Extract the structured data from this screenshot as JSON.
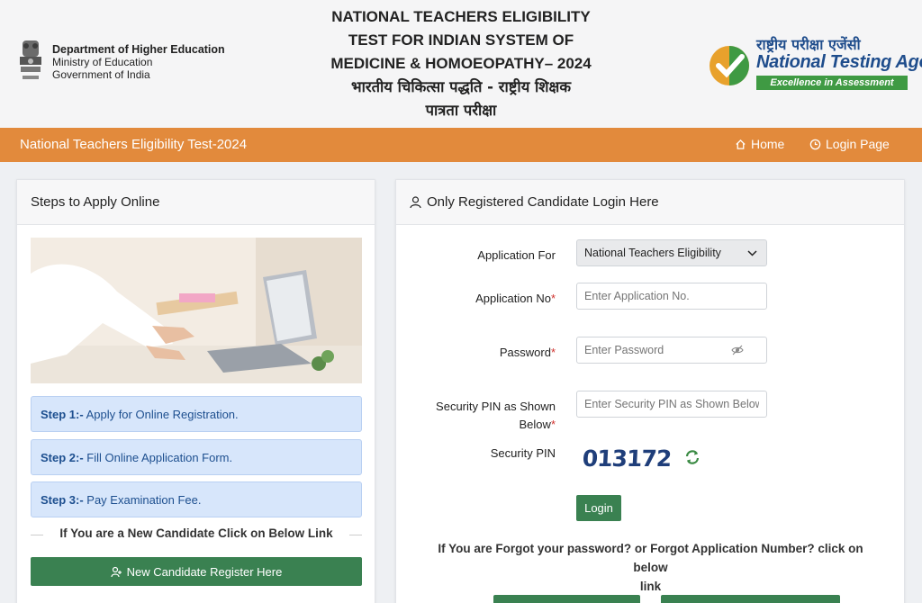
{
  "header": {
    "dept_line1": "Department of Higher Education",
    "dept_line2": "Ministry of Education",
    "dept_line3": "Government of India",
    "title_en_1": "NATIONAL TEACHERS ELIGIBILITY",
    "title_en_2": "TEST FOR INDIAN SYSTEM OF",
    "title_en_3": "MEDICINE & HOMOEOPATHY– 2024",
    "title_hi_1": "भारतीय चिकित्सा पद्धति - राष्ट्रीय शिक्षक",
    "title_hi_2": "पात्रता परीक्षा",
    "nta_hindi": "राष्ट्रीय परीक्षा एजेंसी",
    "nta_english": "National Testing Agency",
    "nta_tagline": "Excellence in Assessment"
  },
  "nav": {
    "brand": "National Teachers Eligibility Test-2024",
    "home": "Home",
    "login_page": "Login Page"
  },
  "left_panel": {
    "heading": "Steps to Apply Online",
    "steps": [
      {
        "prefix": "Step 1:-",
        "text": " Apply for Online Registration."
      },
      {
        "prefix": "Step 2:-",
        "text": " Fill Online Application Form."
      },
      {
        "prefix": "Step 3:-",
        "text": " Pay Examination Fee."
      }
    ],
    "new_candidate_text": "If You are a New Candidate Click on Below Link",
    "register_button": "New Candidate Register Here"
  },
  "right_panel": {
    "heading": "Only Registered Candidate Login Here",
    "application_for_label": "Application For",
    "application_for_value": "National Teachers Eligibility",
    "application_no_label": "Application No",
    "application_no_placeholder": "Enter Application No.",
    "password_label": "Password",
    "password_placeholder": "Enter Password",
    "security_pin_label_1": "Security PIN as Shown",
    "security_pin_label_2": "Below",
    "security_pin_placeholder": "Enter Security PIN as Shown Below",
    "security_pin_display_label": "Security PIN",
    "captcha_value": "013172",
    "login_button": "Login",
    "forgot_text_1": "If You are Forgot your password? or Forgot Application Number? click on below",
    "forgot_text_2": "link",
    "required_mark": "*"
  },
  "colors": {
    "nav_orange": "#e28a3c",
    "button_green": "#3a8151",
    "step_blue": "#d7e6fb"
  }
}
